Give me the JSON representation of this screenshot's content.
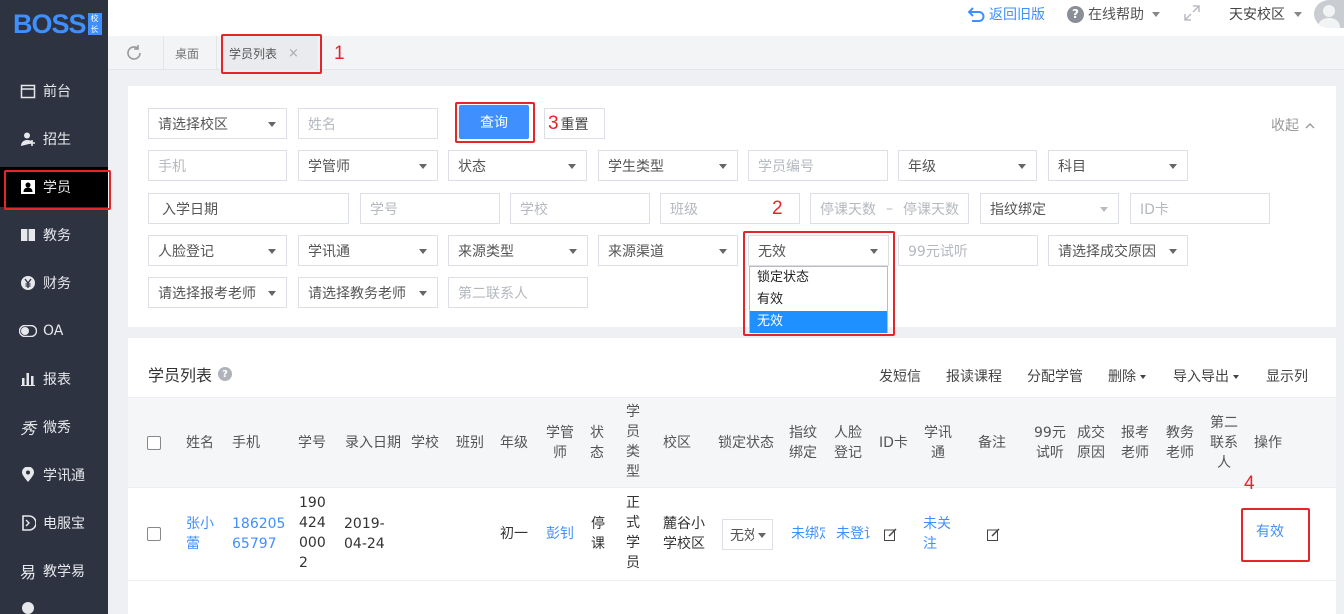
{
  "sidebar": {
    "logo": "BOSS",
    "logo_badge": "校长",
    "items": [
      {
        "label": "前台",
        "icon": "calendar-icon"
      },
      {
        "label": "招生",
        "icon": "add-user-icon"
      },
      {
        "label": "学员",
        "icon": "student-card-icon"
      },
      {
        "label": "教务",
        "icon": "book-icon"
      },
      {
        "label": "财务",
        "icon": "yen-icon"
      },
      {
        "label": "OA",
        "icon": "toggle-icon"
      },
      {
        "label": "报表",
        "icon": "bar-chart-icon"
      },
      {
        "label": "微秀",
        "icon": "show-icon"
      },
      {
        "label": "学讯通",
        "icon": "location-icon"
      },
      {
        "label": "电服宝",
        "icon": "phone-service-icon"
      },
      {
        "label": "教学易",
        "icon": "teaching-icon"
      }
    ]
  },
  "topbar": {
    "back_old": "返回旧版",
    "help": "在线帮助",
    "campus": "天安校区"
  },
  "tabs": {
    "home": "桌面",
    "active": "学员列表",
    "close": "×"
  },
  "filters": {
    "campus": "请选择校区",
    "name": "姓名",
    "query": "查询",
    "reset": "重置",
    "collapse": "收起",
    "phone": "手机",
    "manager": "学管师",
    "status": "状态",
    "student_type": "学生类型",
    "student_no": "学员编号",
    "grade": "年级",
    "subject": "科目",
    "enroll_date": "入学日期",
    "xuehao": "学号",
    "school": "学校",
    "class": "班级",
    "stop_from": "停课天数",
    "stop_dash": "–",
    "stop_to": "停课天数",
    "fingerprint": "指纹绑定",
    "id_card": "ID卡",
    "face": "人脸登记",
    "xunxuntong": "学讯通",
    "source_type": "来源类型",
    "source_channel": "来源渠道",
    "lock_status": "无效",
    "trial": "99元试听",
    "deal_reason": "请选择成交原因",
    "exam_teacher": "请选择报考老师",
    "edu_teacher": "请选择教务老师",
    "second_contact": "第二联系人",
    "lock_options": [
      "锁定状态",
      "有效",
      "无效"
    ]
  },
  "annotations": [
    "1",
    "2",
    "3",
    "4"
  ],
  "list": {
    "title": "学员列表",
    "toolbar": {
      "sms": "发短信",
      "enroll": "报读课程",
      "assign": "分配学管",
      "delete": "删除",
      "import_export": "导入导出",
      "display": "显示列"
    },
    "columns": {
      "name": "姓名",
      "phone": "手机",
      "xuehao": "学号",
      "entry_date": "录入日期",
      "school": "学校",
      "class": "班别",
      "grade": "年级",
      "manager_1": "学管",
      "manager_2": "师",
      "status_1": "状",
      "status_2": "态",
      "type_1": "学",
      "type_2": "员",
      "type_3": "类",
      "type_4": "型",
      "campus": "校区",
      "lock": "锁定状态",
      "finger_1": "指纹",
      "finger_2": "绑定",
      "face_1": "人脸",
      "face_2": "登记",
      "idcard": "ID卡",
      "xxt_1": "学讯",
      "xxt_2": "通",
      "remark": "备注",
      "trial_1": "99元",
      "trial_2": "试听",
      "deal_1": "成交",
      "deal_2": "原因",
      "exam_1": "报考",
      "exam_2": "老师",
      "edu_1": "教务",
      "edu_2": "老师",
      "second_1": "第二",
      "second_2": "联系",
      "second_3": "人",
      "ops": "操作"
    },
    "row": {
      "name_1": "张小",
      "name_2": "蕾",
      "phone_1": "186205",
      "phone_2": "65797",
      "no_1": "190",
      "no_2": "424",
      "no_3": "000",
      "no_4": "2",
      "date_1": "2019-",
      "date_2": "04-24",
      "grade": "初一",
      "manager": "彭钊",
      "status_1": "停",
      "status_2": "课",
      "type_1": "正",
      "type_2": "式",
      "type_3": "学",
      "type_4": "员",
      "campus_1": "麓谷小",
      "campus_2": "学校区",
      "lock": "无效",
      "finger": "未绑定",
      "face": "未登记",
      "xxt_1": "未关",
      "xxt_2": "注",
      "action": "有效"
    }
  }
}
